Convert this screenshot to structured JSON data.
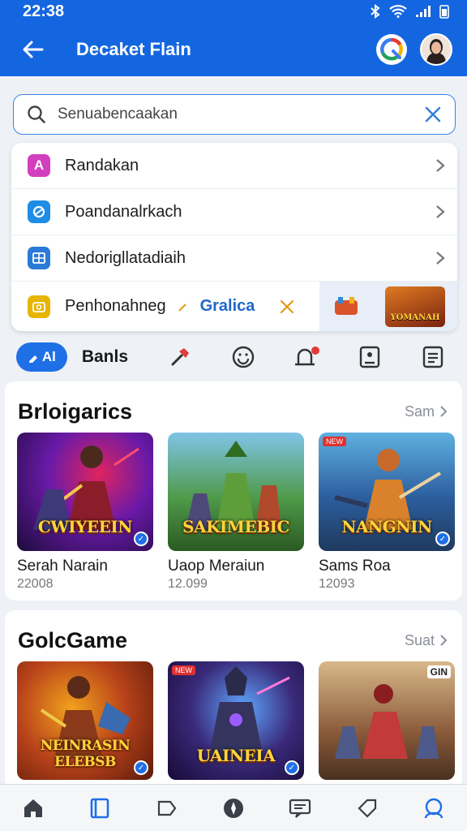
{
  "status": {
    "time": "22:38"
  },
  "header": {
    "title": "Decaket Flain"
  },
  "search": {
    "value": "Senuabencaakan"
  },
  "suggestions": {
    "items": [
      {
        "label": "Randakan",
        "icon": "letter-a-icon",
        "color": "#c93fb8",
        "glyph": "A"
      },
      {
        "label": "Poandanalrkach",
        "icon": "shield-icon",
        "color": "#1f8ce6",
        "glyph": "◉"
      },
      {
        "label": "Nedorigllatadiaih",
        "icon": "grid-icon",
        "color": "#2a7ad8",
        "glyph": "▦"
      }
    ],
    "last": {
      "label": "Penhonahneg",
      "chip": "Gralica",
      "icon": "folder-icon",
      "color": "#e7b400",
      "thumb_text": "YOMANAH"
    }
  },
  "filter": {
    "all_label": "Al",
    "label": "Banls"
  },
  "sections": [
    {
      "title": "Brloigarics",
      "see_all": "Sam",
      "cards": [
        {
          "art_title": "CWIYEEIN",
          "name": "Serah Narain",
          "meta": "22008",
          "bg": "#6a1aa8",
          "accent": "#e0245e"
        },
        {
          "art_title": "SAKIMEBIC",
          "name": "Uaop Meraiun",
          "meta": "12.099",
          "bg": "#3d7a3a",
          "accent": "#8fc34a"
        },
        {
          "art_title": "NANGNIN",
          "name": "Sams Roa",
          "meta": "12093",
          "bg": "#2c5e9e",
          "accent": "#d9822b",
          "tag": "NEW"
        }
      ]
    },
    {
      "title": "GolcGame",
      "see_all": "Suat",
      "cards": [
        {
          "art_title": "NEINRASIN ELEBSB",
          "bg": "#b8421a",
          "accent": "#f2a21c",
          "tag": ""
        },
        {
          "art_title": "UAINEIA",
          "bg": "#3a2a7a",
          "accent": "#5fa8ff",
          "tag": "NEW"
        },
        {
          "art_title": "",
          "bg": "#8a5a3a",
          "accent": "#c23a3a",
          "tag": "GIN"
        }
      ]
    }
  ]
}
